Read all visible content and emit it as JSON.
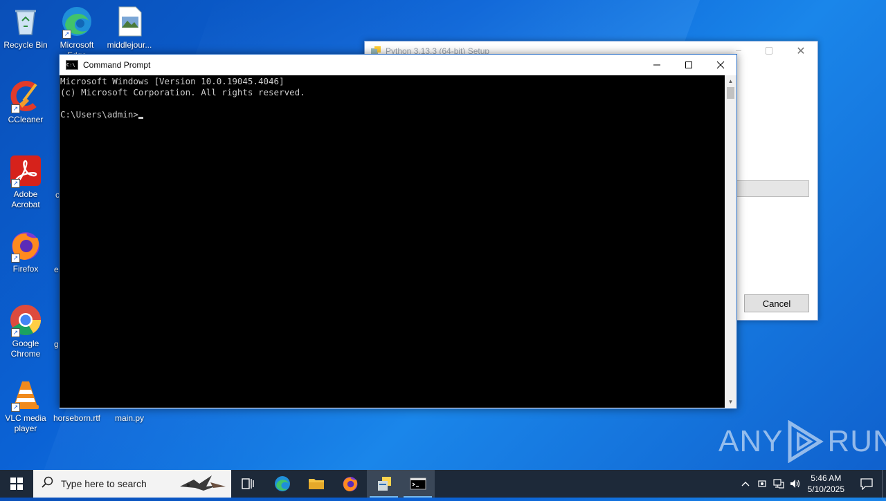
{
  "desktop": {
    "icons": [
      {
        "label": "Recycle Bin"
      },
      {
        "label": "Microsoft Edge"
      },
      {
        "label": "middlejour..."
      },
      {
        "label": "CCleaner"
      },
      {
        "label": "Adobe Acrobat"
      },
      {
        "label": "Firefox"
      },
      {
        "label": "Google Chrome"
      },
      {
        "label": "VLC media player"
      },
      {
        "label": "horseborn.rtf"
      },
      {
        "label": "main.py"
      }
    ],
    "partial_labels": [
      "c",
      "e",
      "g"
    ]
  },
  "setup_window": {
    "title": "Python 3.13.3 (64-bit) Setup",
    "cancel_label": "Cancel"
  },
  "cmd_window": {
    "title": "Command Prompt",
    "lines": [
      "Microsoft Windows [Version 10.0.19045.4046]",
      "(c) Microsoft Corporation. All rights reserved.",
      "",
      "C:\\Users\\admin>"
    ]
  },
  "watermark": {
    "left": "ANY",
    "right": "RUN"
  },
  "taskbar": {
    "search_placeholder": "Type here to search",
    "time": "5:46 AM",
    "date": "5/10/2025"
  },
  "colors": {
    "console_bg": "#000000",
    "console_text": "#cccccc",
    "taskbar_bg": "#1d2939",
    "accent": "#76b9ed"
  }
}
